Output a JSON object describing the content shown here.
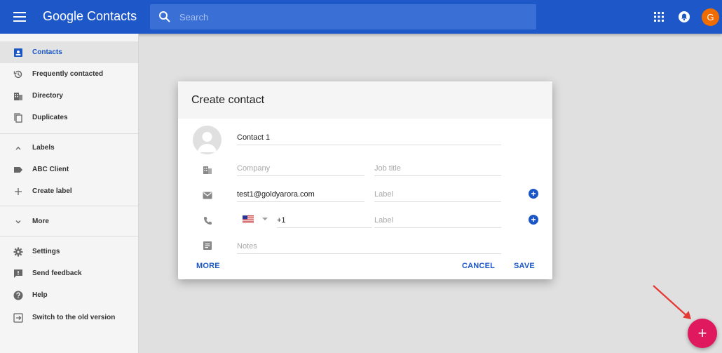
{
  "header": {
    "brand": "Google Contacts",
    "search_placeholder": "Search",
    "avatar_letter": "G"
  },
  "sidebar": {
    "items": [
      {
        "label": "Contacts",
        "icon": "contacts-icon",
        "active": true
      },
      {
        "label": "Frequently contacted",
        "icon": "history-icon"
      },
      {
        "label": "Directory",
        "icon": "directory-icon"
      },
      {
        "label": "Duplicates",
        "icon": "duplicates-icon"
      },
      {
        "label": "Labels",
        "icon": "chevron-up-icon"
      },
      {
        "label": "ABC Client",
        "icon": "label-icon"
      },
      {
        "label": "Create label",
        "icon": "plus-icon"
      },
      {
        "label": "More",
        "icon": "chevron-down-icon"
      },
      {
        "label": "Settings",
        "icon": "gear-icon"
      },
      {
        "label": "Send feedback",
        "icon": "feedback-icon"
      },
      {
        "label": "Help",
        "icon": "help-icon"
      },
      {
        "label": "Switch to the old version",
        "icon": "exit-icon"
      }
    ]
  },
  "dialog": {
    "title": "Create contact",
    "name_value": "Contact 1",
    "company_placeholder": "Company",
    "job_title_placeholder": "Job title",
    "email_value": "test1@goldyarora.com",
    "email_label_placeholder": "Label",
    "phone_value": "+1",
    "phone_label_placeholder": "Label",
    "notes_placeholder": "Notes",
    "more_label": "MORE",
    "cancel_label": "CANCEL",
    "save_label": "SAVE"
  },
  "fab": {
    "label": "+"
  },
  "colors": {
    "header_bg": "#1e57c7",
    "accent": "#1a56c6",
    "fab": "#e0185e",
    "avatar": "#ef6c00",
    "annotation_arrow": "#e53935"
  }
}
